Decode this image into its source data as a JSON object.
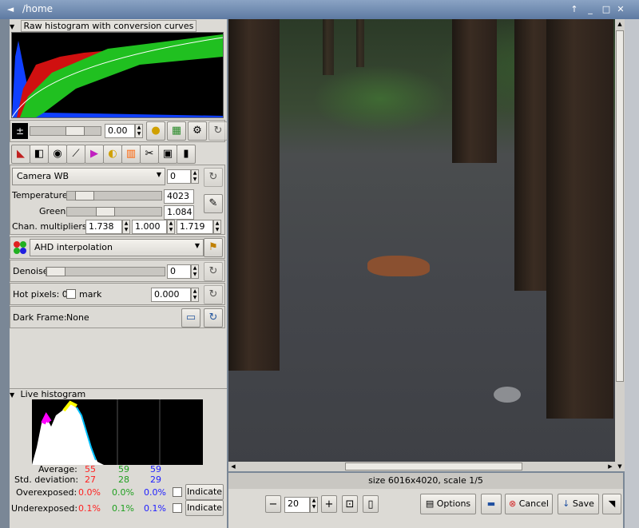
{
  "window": {
    "title": "/home"
  },
  "raw_histogram": {
    "title": "Raw histogram with conversion curves"
  },
  "exposure": {
    "value": "0.00"
  },
  "wb": {
    "preset": "Camera WB",
    "preset_value": "0",
    "temperature_label": "Temperature",
    "temperature_value": "4023",
    "green_label": "Green",
    "green_value": "1.084",
    "multipliers_label": "Chan. multipliers:",
    "mult_r": "1.738",
    "mult_g": "1.000",
    "mult_b": "1.719"
  },
  "interpolation": {
    "value": "AHD interpolation"
  },
  "denoise": {
    "label": "Denoise",
    "value": "0"
  },
  "hotpixels": {
    "label": "Hot pixels: 0",
    "mark_label": "mark",
    "value": "0.000"
  },
  "darkframe": {
    "label": "Dark Frame:",
    "value": "None"
  },
  "live_histogram": {
    "title": "Live histogram",
    "average_label": "Average:",
    "avg": [
      "55",
      "59",
      "59"
    ],
    "std_label": "Std. deviation:",
    "std": [
      "27",
      "28",
      "29"
    ],
    "over_label": "Overexposed:",
    "over": [
      "0.0%",
      "0.0%",
      "0.0%"
    ],
    "under_label": "Underexposed:",
    "under": [
      "0.1%",
      "0.1%",
      "0.1%"
    ],
    "indicate_label": "Indicate"
  },
  "status": {
    "text": "size 6016x4020, scale 1/5"
  },
  "toolbar": {
    "zoom_value": "20",
    "options_label": "Options",
    "cancel_label": "Cancel",
    "save_label": "Save"
  },
  "colors": {
    "red": "#ff2020",
    "green": "#20a020",
    "blue": "#2020ff"
  }
}
